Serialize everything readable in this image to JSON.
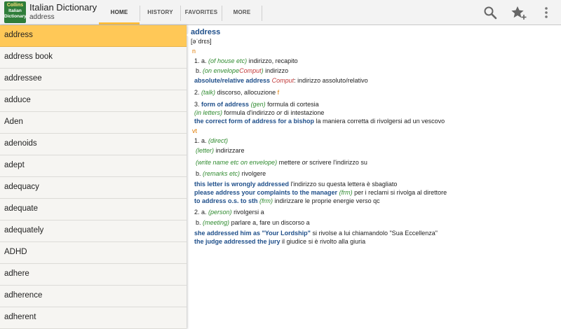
{
  "app": {
    "title": "Italian Dictionary",
    "subtitle": "address",
    "logo_lines": [
      "Collins",
      "Italian",
      "Dictionary"
    ]
  },
  "tabs": [
    {
      "label": "HOME",
      "active": true
    },
    {
      "label": "HISTORY",
      "active": false
    },
    {
      "label": "FAVORITES",
      "active": false
    },
    {
      "label": "MORE",
      "active": false
    }
  ],
  "actions": [
    "search-icon",
    "add-favorite-icon",
    "overflow-menu-icon"
  ],
  "colors": {
    "accent": "#ffbf3a",
    "selected_row": "#ffc857",
    "headword": "#1f4f8a",
    "pos": "#e07a00",
    "label_green": "#2e8a2e",
    "subject_red": "#c23b3b"
  },
  "sidebar": {
    "items": [
      {
        "label": "address",
        "selected": true
      },
      {
        "label": "address book",
        "selected": false
      },
      {
        "label": "addressee",
        "selected": false
      },
      {
        "label": "adduce",
        "selected": false
      },
      {
        "label": "Aden",
        "selected": false
      },
      {
        "label": "adenoids",
        "selected": false
      },
      {
        "label": "adept",
        "selected": false
      },
      {
        "label": "adequacy",
        "selected": false
      },
      {
        "label": "adequate",
        "selected": false
      },
      {
        "label": "adequately",
        "selected": false
      },
      {
        "label": "ADHD",
        "selected": false
      },
      {
        "label": "adhere",
        "selected": false
      },
      {
        "label": "adherence",
        "selected": false
      },
      {
        "label": "adherent",
        "selected": false
      }
    ]
  },
  "entry": {
    "headword": "address",
    "pronunciation": "[əˈdrɛs]",
    "pos_n": "n",
    "pos_vt": "vt",
    "n1a": {
      "num": "1. a.",
      "label": "(of house etc)",
      "text": "indirizzo, recapito"
    },
    "n1b": {
      "num": "b.",
      "label": "(on envelope",
      "subject": "Comput",
      "label_end": ")",
      "text": "indirizzo"
    },
    "n1_phrase": {
      "phrase": "absolute/relative address",
      "subject": "Comput",
      "text": ": indirizzo assoluto/relativo"
    },
    "n2": {
      "num": "2.",
      "label": "(talk)",
      "text": "discorso, allocuzione",
      "gender": "f"
    },
    "n3": {
      "num": "3.",
      "phrase": "form of address",
      "label": "(gen)",
      "text": "formula di cortesia"
    },
    "n3_line2": {
      "label": "(in letters)",
      "text1": "formula d'indirizzo",
      "or": "or",
      "text2": "di intestazione"
    },
    "n3_line3": {
      "phrase": "the correct form of address for a bishop",
      "text": "la maniera corretta di rivolgersi ad un vescovo"
    },
    "vt1a": {
      "num": "1. a.",
      "label": "(direct)"
    },
    "vt1a_line2": {
      "label": "(letter)",
      "text": "indirizzare"
    },
    "vt1a_line3": {
      "label": "(write name etc on envelope)",
      "text1": "mettere",
      "or": "or",
      "text2": "scrivere l'indirizzo su"
    },
    "vt1b": {
      "num": "b.",
      "label": "(remarks etc)",
      "text": "rivolgere"
    },
    "vt_ex1": {
      "phrase": "this letter is wrongly addressed",
      "text": "l'indirizzo su questa lettera è sbagliato"
    },
    "vt_ex2": {
      "phrase": "please address your complaints to the manager",
      "label": "(frm)",
      "text": "per i reclami si rivolga al direttore"
    },
    "vt_ex3": {
      "phrase": "to address o.s. to sth",
      "label": "(frm)",
      "text": "indirizzare le proprie energie verso qc"
    },
    "vt2a": {
      "num": "2. a.",
      "label": "(person)",
      "text": "rivolgersi a"
    },
    "vt2b": {
      "num": "b.",
      "label": "(meeting)",
      "text": "parlare a, fare un discorso a"
    },
    "vt_ex4": {
      "phrase": "she addressed him as \"Your Lordship\"",
      "text": "si rivolse a lui chiamandolo \"Sua Eccellenza\""
    },
    "vt_ex5": {
      "phrase": "the judge addressed the jury",
      "text": "il giudice si è rivolto alla giuria"
    }
  }
}
